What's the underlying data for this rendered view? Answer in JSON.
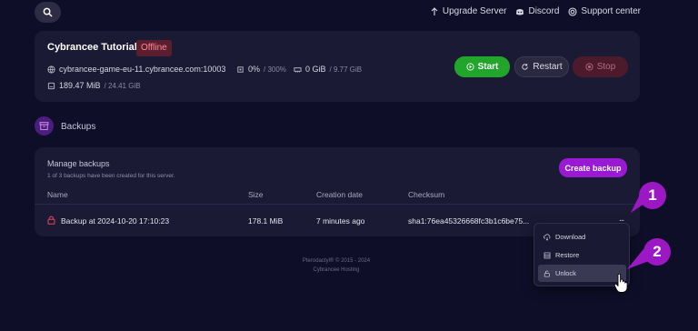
{
  "topnav": {
    "upgrade": "Upgrade Server",
    "discord": "Discord",
    "support": "Support center"
  },
  "server": {
    "name": "Cybrancee Tutorials",
    "status": "Offline",
    "address": "cybrancee-game-eu-11.cybrancee.com:10003",
    "cpu_value": "0%",
    "cpu_limit": "/ 300%",
    "memory_value": "0 GiB",
    "memory_limit": "/ 9.77 GiB",
    "disk_value": "189.47 MiB",
    "disk_limit": "/ 24.41 GiB",
    "start_label": "Start",
    "restart_label": "Restart",
    "stop_label": "Stop"
  },
  "backups": {
    "section_title": "Backups",
    "manage_title": "Manage backups",
    "manage_subtitle": "1 of 3 backups have been created for this server.",
    "create_label": "Create backup",
    "columns": [
      "Name",
      "Size",
      "Creation date",
      "Checksum"
    ],
    "rows": [
      {
        "name": "Backup at 2024-10-20 17:10:23",
        "size": "178.1 MiB",
        "created": "7 minutes ago",
        "checksum": "sha1:76ea45326668fc3b1c6be75..."
      }
    ],
    "row_menu": "...",
    "menu": [
      "Download",
      "Restore",
      "Unlock"
    ]
  },
  "callouts": [
    "1",
    "2"
  ],
  "footer": {
    "line1": "Pterodactyl® © 2015 - 2024",
    "line2": "Cybrancee Hosting"
  },
  "colors": {
    "background": "#0f0e29",
    "card": "#1b1a35",
    "start": "#22a52b",
    "accent": "#9a1ad4",
    "offline": "#5b1e2e"
  }
}
